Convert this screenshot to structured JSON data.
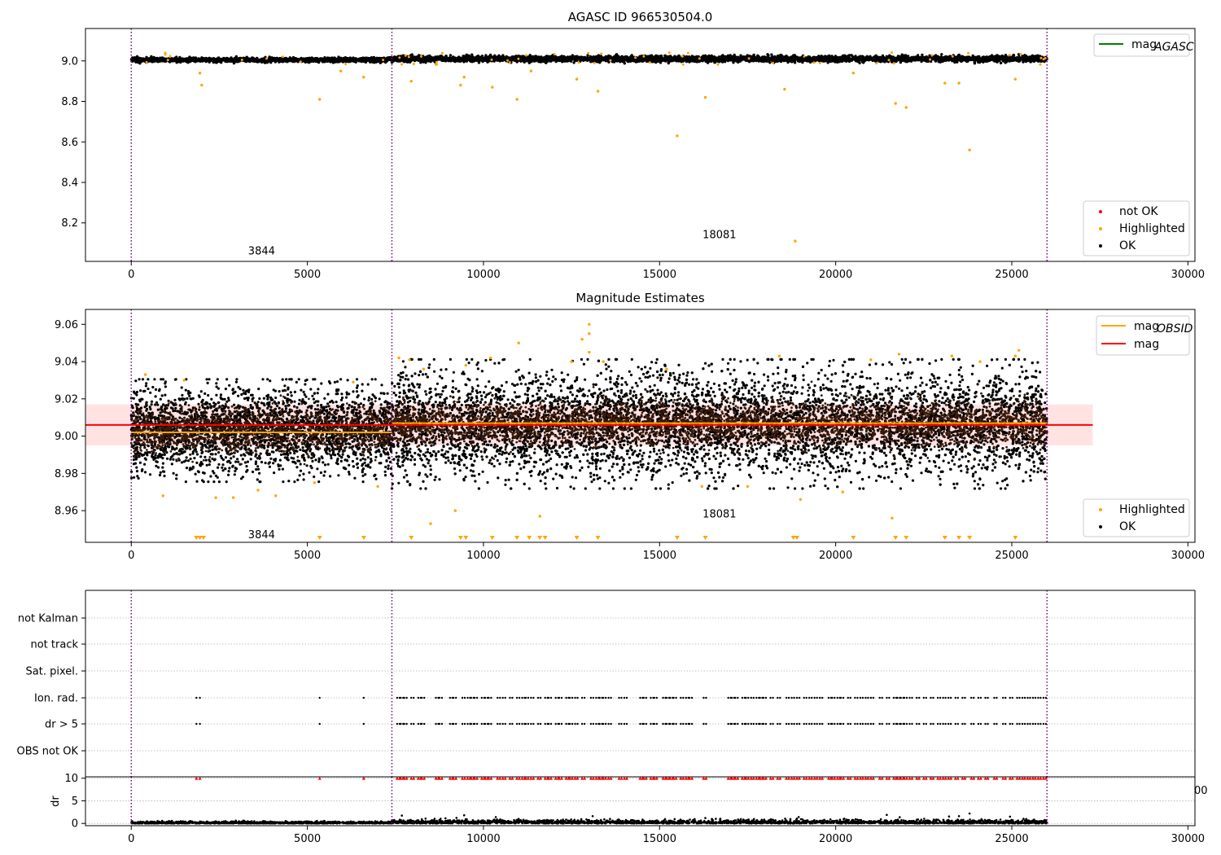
{
  "colors": {
    "ok": "#000000",
    "highlighted": "#ffa500",
    "not_ok": "#ff0000",
    "agasc": "#008000",
    "mag_line": "#ff0000",
    "mag_band": "#ffc0c0",
    "obsid_line": "#ffa500",
    "obsid_boundary": "#800080",
    "grid": "#b0b0b0"
  },
  "chart_data": [
    {
      "type": "scatter",
      "title": "AGASC ID 966530504.0",
      "x_ticks": [
        "0",
        "5000",
        "10000",
        "15000",
        "20000",
        "25000",
        "30000"
      ],
      "x_tick_values": [
        0,
        5000,
        10000,
        15000,
        20000,
        25000,
        30000
      ],
      "xlim": [
        -1300,
        30200
      ],
      "y_ticks": [
        "8.2",
        "8.4",
        "8.6",
        "8.8",
        "9.0"
      ],
      "y_tick_values": [
        8.2,
        8.4,
        8.6,
        8.8,
        9.0
      ],
      "ylim": [
        8.01,
        9.16
      ],
      "obsid_boundaries": [
        0,
        7400,
        26000
      ],
      "obsid_labels": [
        {
          "text": "3844",
          "x": 3700,
          "y": 8.06
        },
        {
          "text": "18081",
          "x": 16700,
          "y": 8.14
        }
      ],
      "ok_band": {
        "segments": [
          [
            0,
            7400,
            8.99,
            9.02
          ],
          [
            7400,
            26000,
            8.99,
            9.03
          ]
        ]
      },
      "highlighted_outliers": [
        [
          1950,
          8.94
        ],
        [
          2000,
          8.88
        ],
        [
          5350,
          8.81
        ],
        [
          5950,
          8.95
        ],
        [
          6600,
          8.92
        ],
        [
          7950,
          8.9
        ],
        [
          9350,
          8.88
        ],
        [
          9450,
          8.92
        ],
        [
          10250,
          8.87
        ],
        [
          10950,
          8.81
        ],
        [
          11350,
          8.95
        ],
        [
          12650,
          8.91
        ],
        [
          13250,
          8.85
        ],
        [
          15500,
          8.63
        ],
        [
          16300,
          8.82
        ],
        [
          18550,
          8.86
        ],
        [
          18850,
          8.11
        ],
        [
          20500,
          8.94
        ],
        [
          21700,
          8.79
        ],
        [
          22000,
          8.77
        ],
        [
          23100,
          8.89
        ],
        [
          23500,
          8.89
        ],
        [
          23800,
          8.56
        ],
        [
          25100,
          8.91
        ]
      ],
      "legend_line": [
        {
          "name": "mag_AGASC",
          "label_main": "mag",
          "label_sub": "AGASC",
          "color": "#008000"
        }
      ],
      "legend_markers": [
        {
          "name": "not OK",
          "color": "#ff0000"
        },
        {
          "name": "Highlighted",
          "color": "#ffa500"
        },
        {
          "name": "OK",
          "color": "#000000"
        }
      ]
    },
    {
      "type": "scatter",
      "title": "Magnitude Estimates",
      "x_ticks": [
        "0",
        "5000",
        "10000",
        "15000",
        "20000",
        "25000",
        "30000"
      ],
      "x_tick_values": [
        0,
        5000,
        10000,
        15000,
        20000,
        25000,
        30000
      ],
      "xlim": [
        -1300,
        30200
      ],
      "y_ticks": [
        "8.96",
        "8.98",
        "9.00",
        "9.02",
        "9.04",
        "9.06"
      ],
      "y_tick_values": [
        8.96,
        8.98,
        9.0,
        9.02,
        9.04,
        9.06
      ],
      "ylim": [
        8.943,
        9.068
      ],
      "obsid_boundaries": [
        0,
        7400,
        26000
      ],
      "obsid_labels": [
        {
          "text": "3844",
          "x": 3700,
          "y": 8.947
        },
        {
          "text": "18081",
          "x": 16700,
          "y": 8.958
        }
      ],
      "mag": 9.006,
      "mag_band": [
        8.995,
        9.017
      ],
      "obsid_means": [
        [
          0,
          7400,
          9.002
        ],
        [
          7400,
          26000,
          9.007
        ]
      ],
      "ok_band": {
        "segments": [
          [
            0,
            7400,
            8.978,
            9.028
          ],
          [
            7400,
            26000,
            8.975,
            9.038
          ]
        ]
      },
      "highlighted_outliers": [
        [
          400,
          9.033
        ],
        [
          900,
          8.968
        ],
        [
          1500,
          9.03
        ],
        [
          2400,
          8.967
        ],
        [
          2900,
          8.967
        ],
        [
          3600,
          8.971
        ],
        [
          4100,
          8.968
        ],
        [
          5200,
          8.975
        ],
        [
          6300,
          9.029
        ],
        [
          7000,
          8.973
        ],
        [
          7600,
          9.042
        ],
        [
          7900,
          9.041
        ],
        [
          8300,
          9.036
        ],
        [
          8500,
          8.953
        ],
        [
          9200,
          8.96
        ],
        [
          9500,
          9.038
        ],
        [
          10200,
          9.042
        ],
        [
          11000,
          9.05
        ],
        [
          11600,
          8.957
        ],
        [
          12500,
          9.04
        ],
        [
          12800,
          9.052
        ],
        [
          13000,
          9.06
        ],
        [
          13000,
          9.055
        ],
        [
          13000,
          9.045
        ],
        [
          13400,
          9.04
        ],
        [
          15200,
          9.036
        ],
        [
          16200,
          8.973
        ],
        [
          17500,
          8.973
        ],
        [
          18400,
          9.043
        ],
        [
          19000,
          8.966
        ],
        [
          20200,
          8.97
        ],
        [
          21000,
          9.041
        ],
        [
          21600,
          8.956
        ],
        [
          21800,
          9.044
        ],
        [
          23300,
          9.043
        ],
        [
          24100,
          9.04
        ],
        [
          25100,
          9.043
        ],
        [
          25200,
          9.046
        ]
      ],
      "clipped_highlighted_x": [
        1850,
        1950,
        2050,
        5350,
        6600,
        7950,
        9350,
        9500,
        10250,
        10950,
        11300,
        11600,
        11750,
        12650,
        13250,
        15500,
        16300,
        18800,
        18900,
        20500,
        21700,
        22000,
        23100,
        23500,
        23800,
        25100
      ],
      "legend_line": [
        {
          "name": "mag_OBSID",
          "label_main": "mag",
          "label_sub": "OBSID",
          "color": "#ffa500"
        },
        {
          "name": "mag",
          "label_main": "mag",
          "label_sub": "",
          "color": "#ff0000"
        }
      ],
      "legend_markers": [
        {
          "name": "Highlighted",
          "color": "#ffa500"
        },
        {
          "name": "OK",
          "color": "#000000"
        }
      ]
    },
    {
      "type": "scatter",
      "categories": [
        "not Kalman",
        "not track",
        "Sat. pixel.",
        "Ion. rad.",
        "dr > 5",
        "OBS not OK"
      ],
      "obsid_boundaries": [
        0,
        7400,
        26000
      ],
      "flag_x": [
        1850,
        1950,
        5350,
        6600,
        7550,
        7650,
        7750,
        7950,
        8150,
        8250,
        8650,
        8750,
        9050,
        9150,
        9400,
        9550,
        9650,
        9750,
        9950,
        10050,
        10150,
        10400,
        10550,
        10750,
        10950,
        11100,
        11200,
        11350,
        11550,
        11750,
        11850,
        12050,
        12150,
        12350,
        12450,
        12600,
        12800,
        13050,
        13200,
        13300,
        13400,
        13550,
        13850,
        14000,
        14450,
        14550,
        14750,
        14850,
        15100,
        15200,
        15300,
        15400,
        15600,
        15750,
        15850,
        16250,
        16950,
        17050,
        17150,
        17350,
        17450,
        17600,
        17750,
        17850,
        17950,
        18150,
        18350,
        18600,
        18750,
        18900,
        19100,
        19250,
        19400,
        19550,
        19800,
        19900,
        20050,
        20150,
        20350,
        20550,
        20700,
        20850,
        21000,
        21250,
        21450,
        21650,
        21750,
        21850,
        21950,
        22100,
        22300,
        22500,
        22700,
        22900,
        23050,
        23200,
        23400,
        23600,
        23850,
        24050,
        24250,
        24500,
        24750,
        24950,
        25150,
        25300,
        25450,
        25600,
        25750,
        25900
      ]
    },
    {
      "type": "scatter",
      "ylabel": "dr",
      "x_ticks": [
        "0",
        "5000",
        "10000",
        "15000",
        "20000",
        "25000",
        "30000"
      ],
      "x_tick_values": [
        0,
        5000,
        10000,
        15000,
        20000,
        25000,
        30000
      ],
      "xlim": [
        -1300,
        30200
      ],
      "y_ticks": [
        "0",
        "5",
        "10"
      ],
      "y_tick_values": [
        0,
        5,
        10
      ],
      "ylim": [
        -0.5,
        10.3
      ],
      "obsid_boundaries": [
        0,
        7400,
        26000
      ],
      "clip_value": 10,
      "clipped_x_ref": "flag_x",
      "scatter_points": [
        [
          9450,
          1.8
        ],
        [
          10350,
          1.4
        ],
        [
          11000,
          1.0
        ],
        [
          13100,
          1.6
        ],
        [
          16300,
          1.2
        ],
        [
          18950,
          1.4
        ],
        [
          21450,
          1.9
        ],
        [
          23500,
          1.6
        ],
        [
          23800,
          2.2
        ],
        [
          24950,
          1.5
        ]
      ],
      "partial_tick_label": "00"
    }
  ]
}
